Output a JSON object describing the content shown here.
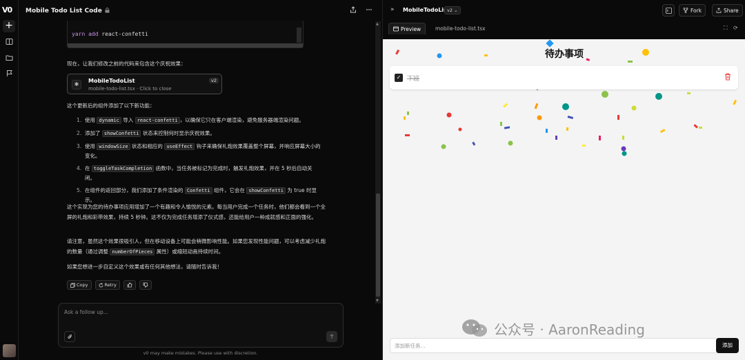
{
  "rail": {
    "logo": "V0",
    "new_icon": "+",
    "icons": [
      "book-icon",
      "folder-icon",
      "flag-icon"
    ]
  },
  "chat": {
    "title": "Mobile Todo List Code",
    "code_line_kw": "yarn add",
    "code_line_arg": " react-confetti",
    "intro": "现在，让我们修改之前的代码来包含这个庆祝效果：",
    "card": {
      "name": "MobileTodoList",
      "subtitle": "mobile-todo-list.tsx · Click to close",
      "version": "v2"
    },
    "features_heading": "这个更新后的组件添加了以下新功能：",
    "features": [
      {
        "num": "1.",
        "a": "使用 ",
        "c1": "dynamic",
        "b": " 导入 ",
        "c2": "react-confetti",
        "d": "，以确保它只在客户端渲染，避免服务器端渲染问题。"
      },
      {
        "num": "2.",
        "a": "添加了 ",
        "c1": "showConfetti",
        "b": " 状态来控制何时显示庆祝效果。",
        "c2": "",
        "d": ""
      },
      {
        "num": "3.",
        "a": "使用 ",
        "c1": "windowSize",
        "b": " 状态和相应的 ",
        "c2": "useEffect",
        "d": " 钩子来确保礼炮效果覆盖整个屏幕，并响应屏幕大小的变化。"
      },
      {
        "num": "4.",
        "a": "在 ",
        "c1": "toggleTaskCompletion",
        "b": " 函数中，当任务被标记为完成时，触发礼炮效果，并在 5 秒后自动关闭。",
        "c2": "",
        "d": ""
      },
      {
        "num": "5.",
        "a": "在组件的返回部分，我们添加了条件渲染的 ",
        "c1": "Confetti",
        "b": " 组件，它会在 ",
        "c2": "showConfetti",
        "d": " 为 true 时显示。"
      }
    ],
    "para1": "这个实现为您的待办事项应用增加了一个有趣和令人愉悦的元素。每当用户完成一个任务时，他们都会看到一个全屏的礼炮和彩带效果，持续 5 秒钟。这不仅为完成任务增添了仪式感，还能给用户一种成就感和正面的强化。",
    "para2_a": "请注意，虽然这个效果很吸引人，但在移动设备上可能会稍微影响性能。如果您发现性能问题，可以考虑减少礼炮的数量（通过调整 ",
    "para2_code": "numberOfPieces",
    "para2_b": " 属性）或缩短动画持续时间。",
    "para3": "如果您想进一步自定义这个效果或有任何其他想法，请随时告诉我！",
    "actions": {
      "copy": "Copy",
      "retry": "Retry"
    },
    "composer_placeholder": "Ask a follow up...",
    "disclaimer": "v0 may make mistakes. Please use with discretion."
  },
  "preview": {
    "name": "MobileTodoList",
    "version": "v2",
    "fork": "Fork",
    "share": "Share",
    "tab_preview": "Preview",
    "tab_file": "mobile-todo-list.tsx",
    "app_title": "待办事项",
    "todo_text": "下班",
    "input_placeholder": "添加新任务...",
    "add_button": "添加"
  },
  "watermark": "公众号 · AaronReading"
}
